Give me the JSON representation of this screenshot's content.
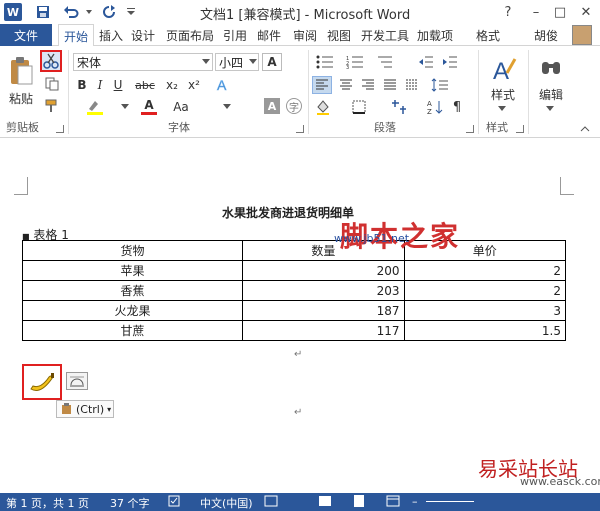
{
  "window": {
    "title": "文档1 [兼容模式] - Microsoft Word",
    "logo_letter": "W",
    "help": "?",
    "minimize": "–",
    "restore": "□",
    "close": "✕"
  },
  "quick_access": {
    "save_icon": "save-icon",
    "undo_icon": "undo-icon",
    "redo_icon": "redo-icon"
  },
  "tabs": {
    "file": "文件",
    "items": [
      "开始",
      "插入",
      "设计",
      "页面布局",
      "引用",
      "邮件",
      "审阅",
      "视图",
      "开发工具",
      "加载项",
      "格式"
    ],
    "user": "胡俊"
  },
  "ribbon": {
    "clipboard": {
      "paste": "粘贴",
      "label": "剪贴板"
    },
    "font": {
      "name": "宋体",
      "size": "小四",
      "label": "字体",
      "bold": "B",
      "italic": "I",
      "underline": "U",
      "strike": "abc",
      "sub": "x₂",
      "sup": "x²",
      "grow": "A",
      "shrink": "A",
      "clear": "A",
      "change_case": "Aa",
      "font_color": "A",
      "highlight": "ab",
      "char_border": "A",
      "char_shade": "字"
    },
    "paragraph": {
      "label": "段落"
    },
    "styles": {
      "button": "样式",
      "label": "样式"
    },
    "editing": {
      "button": "编辑"
    }
  },
  "document": {
    "title": "水果批发商进退货明细单",
    "caption": "表格 1",
    "table": {
      "headers": [
        "货物",
        "数量",
        "单价"
      ],
      "rows": [
        [
          "苹果",
          "200",
          "2"
        ],
        [
          "香蕉",
          "203",
          "2"
        ],
        [
          "火龙果",
          "187",
          "3"
        ],
        [
          "甘蔗",
          "117",
          "1.5"
        ]
      ]
    },
    "paste_option": "(Ctrl)"
  },
  "watermark": {
    "text": "脚本之家",
    "url": "www.jb51.net",
    "site": "易采站长站",
    "site_url": "www.easck.com"
  },
  "status": {
    "page": "第 1 页，共 1 页",
    "words": "37 个字",
    "language": "中文(中国)"
  },
  "colors": {
    "accent": "#2b579a",
    "highlight_red": "#e02020"
  }
}
